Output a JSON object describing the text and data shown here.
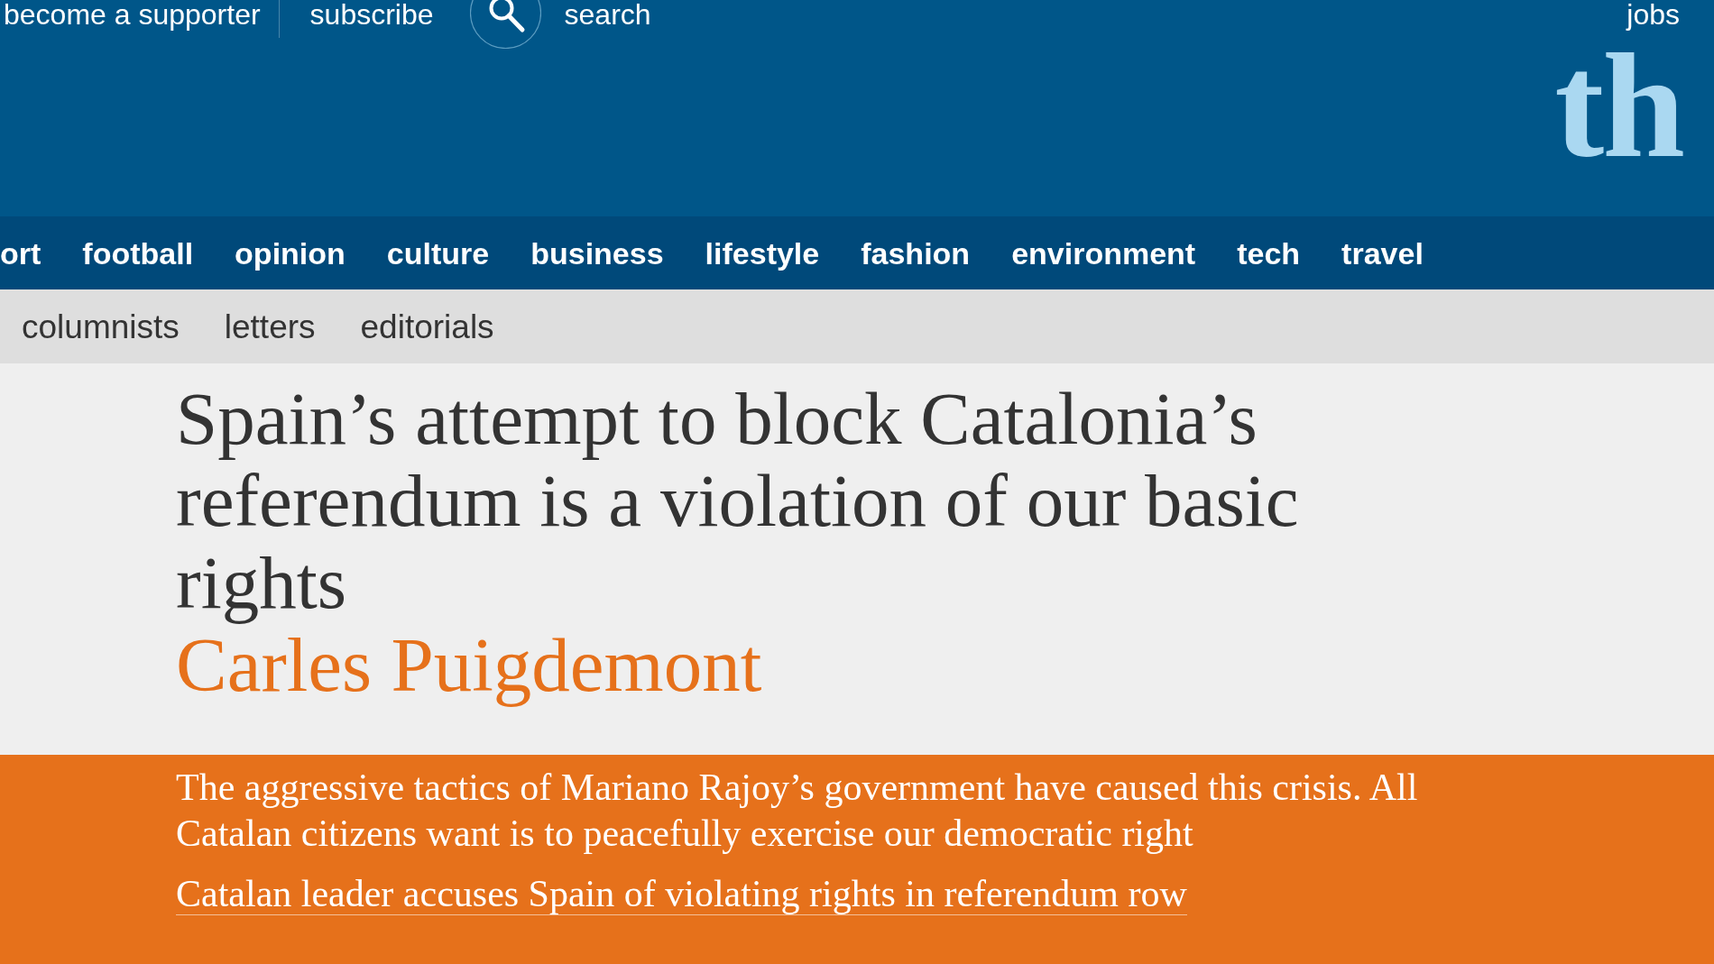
{
  "top_bar": {
    "links": [
      {
        "label": "become a supporter"
      },
      {
        "label": "subscribe"
      }
    ],
    "search": {
      "label": "search"
    },
    "jobs_link": {
      "label": "jobs"
    },
    "logo": {
      "text": "th"
    }
  },
  "nav": {
    "items": [
      {
        "label": "ort"
      },
      {
        "label": "football"
      },
      {
        "label": "opinion"
      },
      {
        "label": "culture"
      },
      {
        "label": "business"
      },
      {
        "label": "lifestyle"
      },
      {
        "label": "fashion"
      },
      {
        "label": "environment"
      },
      {
        "label": "tech"
      },
      {
        "label": "travel"
      }
    ]
  },
  "sub_nav": {
    "items": [
      {
        "label": "columnists"
      },
      {
        "label": "letters"
      },
      {
        "label": "editorials"
      }
    ]
  },
  "article": {
    "headline": "Spain’s attempt to block Catalonia’s referendum is a violation of our basic rights",
    "byline": "Carles Puigdemont",
    "standfirst": "The aggressive tactics of Mariano Rajoy’s government have caused this crisis. All Catalan citizens want is to peacefully exercise our democratic right",
    "related_link": "Catalan leader accuses Spain of violating rights in referendum row"
  }
}
